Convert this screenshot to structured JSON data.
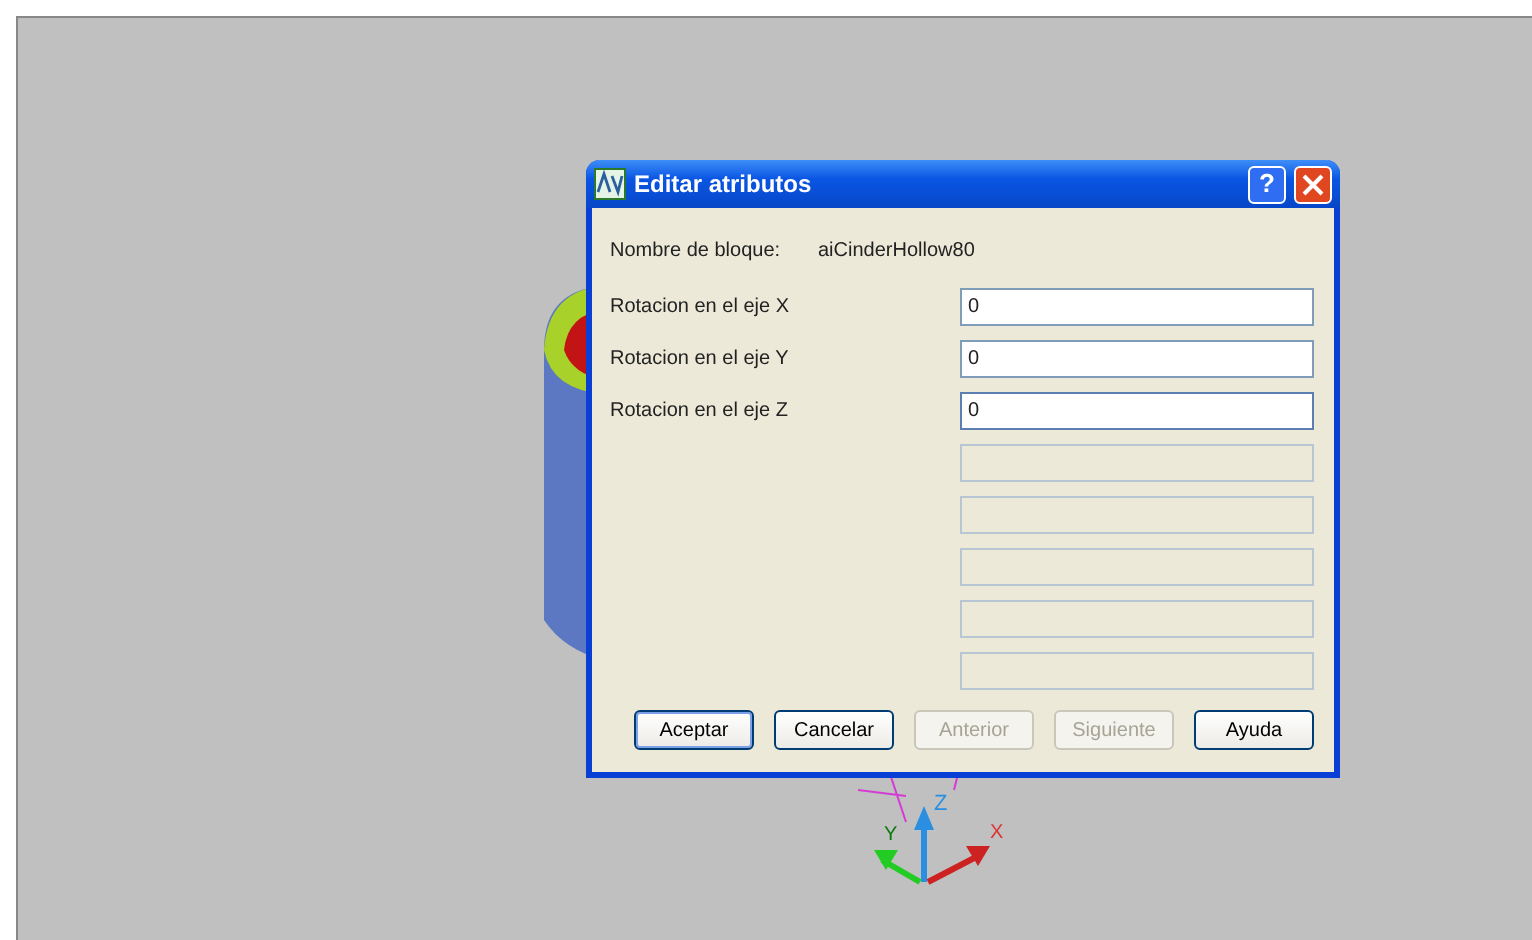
{
  "window": {
    "title": "Editar atributos"
  },
  "block": {
    "label": "Nombre de bloque:",
    "value": "aiCinderHollow80"
  },
  "fields": [
    {
      "label": "Rotacion en el eje X",
      "value": "0",
      "disabled": false,
      "focused": false
    },
    {
      "label": "Rotacion en el eje Y",
      "value": "0",
      "disabled": false,
      "focused": false
    },
    {
      "label": "Rotacion en el eje Z",
      "value": "0",
      "disabled": false,
      "focused": true
    },
    {
      "disabled": true,
      "focused": false
    },
    {
      "disabled": true,
      "focused": false
    },
    {
      "disabled": true,
      "focused": false
    },
    {
      "disabled": true,
      "focused": false
    },
    {
      "disabled": true,
      "focused": false
    }
  ],
  "buttons": [
    {
      "label": "Aceptar",
      "disabled": false,
      "default": true
    },
    {
      "label": "Cancelar",
      "disabled": false,
      "default": false
    },
    {
      "label": "Anterior",
      "disabled": true,
      "default": false
    },
    {
      "label": "Siguiente",
      "disabled": true,
      "default": false
    },
    {
      "label": "Ayuda",
      "disabled": false,
      "default": false
    }
  ],
  "ucs": {
    "x": "X",
    "y": "Y",
    "z": "Z"
  },
  "title_buttons": [
    "?"
  ]
}
